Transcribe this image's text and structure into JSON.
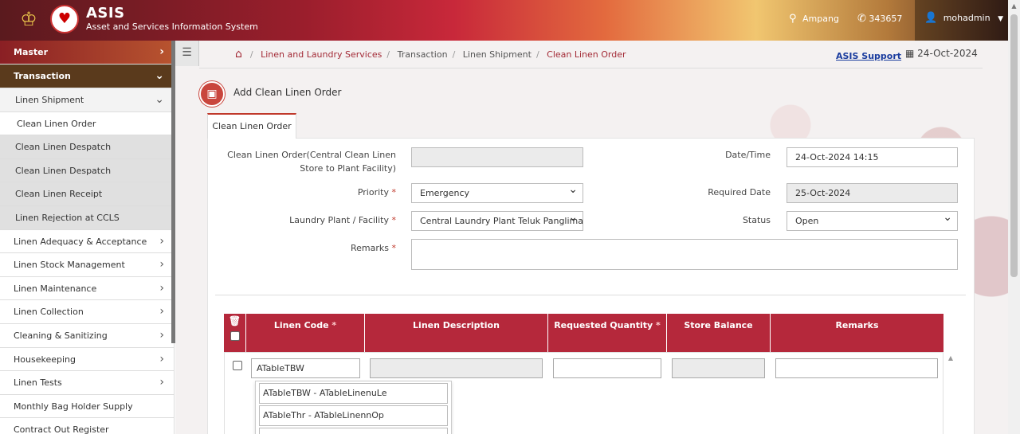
{
  "header": {
    "brand": "ASIS",
    "subtitle": "Asset and Services Information System",
    "location": "Ampang",
    "count": "343657",
    "user": "mohadmin"
  },
  "sidebar": {
    "items": [
      {
        "label": "Master"
      },
      {
        "label": "Transaction"
      },
      {
        "label": "Linen Shipment"
      },
      {
        "label": "Clean Linen Order"
      },
      {
        "label": "Clean Linen Despatch"
      },
      {
        "label": "Clean Linen Despatch"
      },
      {
        "label": "Clean Linen Receipt"
      },
      {
        "label": "Linen Rejection at CCLS"
      },
      {
        "label": "Linen Adequacy & Acceptance"
      },
      {
        "label": "Linen Stock Management"
      },
      {
        "label": "Linen Maintenance"
      },
      {
        "label": "Linen Collection"
      },
      {
        "label": "Cleaning & Sanitizing"
      },
      {
        "label": "Housekeeping"
      },
      {
        "label": "Linen Tests"
      },
      {
        "label": "Monthly Bag Holder Supply"
      },
      {
        "label": "Contract Out Register"
      }
    ]
  },
  "breadcrumb": [
    "Linen and Laundry Services",
    "Transaction",
    "Linen Shipment",
    "Clean Linen Order"
  ],
  "support_link": "ASIS Support",
  "top_date": "24-Oct-2024",
  "page_title": "Add Clean Linen Order",
  "tab_label": "Clean Linen Order",
  "form": {
    "order_label_1": "Clean Linen Order(Central Clean Linen",
    "order_label_2": "Store to Plant Facility)",
    "order_value": "",
    "datetime_label": "Date/Time",
    "datetime_value": "24-Oct-2024 14:15",
    "priority_label": "Priority",
    "priority_value": "Emergency",
    "required_date_label": "Required Date",
    "required_date_value": "25-Oct-2024",
    "plant_label": "Laundry Plant / Facility",
    "plant_value": "Central Laundry Plant Teluk Panglima",
    "status_label": "Status",
    "status_value": "Open",
    "remarks_label": "Remarks",
    "remarks_value": "",
    "required_marker": "*"
  },
  "grid": {
    "headers": {
      "code": "Linen Code",
      "description": "Linen Description",
      "quantity": "Requested Quantity",
      "balance": "Store Balance",
      "remarks": "Remarks"
    },
    "row": {
      "code": "ATableTBW",
      "description": "",
      "quantity": "",
      "balance": "",
      "remarks": ""
    },
    "suggestions": [
      "ATableTBW - ATableLinenuLe",
      "ATableThr - ATableLinennOp"
    ]
  }
}
